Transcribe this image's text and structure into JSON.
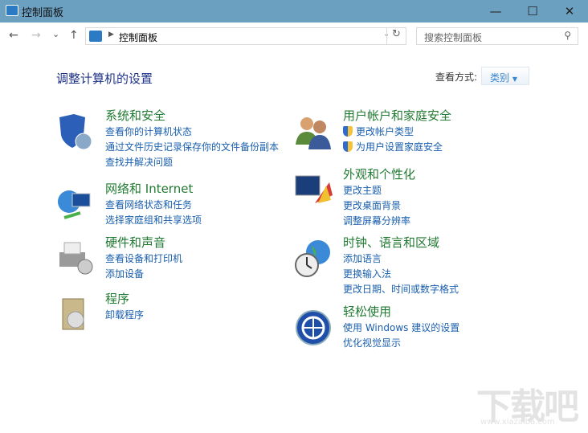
{
  "window": {
    "title": "控制面板",
    "minimize": "—",
    "maximize": "☐",
    "close": "✕"
  },
  "nav": {
    "back": "←",
    "forward": "→",
    "recent": "⌄",
    "up": "↑",
    "address": "控制面板",
    "refresh": "↻",
    "search_placeholder": "搜索控制面板"
  },
  "main": {
    "heading": "调整计算机的设置",
    "view_by_label": "查看方式:",
    "view_by_value": "类别"
  },
  "categories": [
    {
      "title": "系统和安全",
      "links": [
        "查看你的计算机状态",
        "通过文件历史记录保存你的文件备份副本",
        "查找并解决问题"
      ]
    },
    {
      "title": "网络和 Internet",
      "links": [
        "查看网络状态和任务",
        "选择家庭组和共享选项"
      ]
    },
    {
      "title": "硬件和声音",
      "links": [
        "查看设备和打印机",
        "添加设备"
      ]
    },
    {
      "title": "程序",
      "links": [
        "卸载程序"
      ]
    },
    {
      "title": "用户帐户和家庭安全",
      "links": [
        "更改帐户类型",
        "为用户设置家庭安全"
      ]
    },
    {
      "title": "外观和个性化",
      "links": [
        "更改主题",
        "更改桌面背景",
        "调整屏幕分辨率"
      ]
    },
    {
      "title": "时钟、语言和区域",
      "links": [
        "添加语言",
        "更换输入法",
        "更改日期、时间或数字格式"
      ]
    },
    {
      "title": "轻松使用",
      "links": [
        "使用 Windows 建议的设置",
        "优化视觉显示"
      ]
    }
  ],
  "watermark": {
    "text": "下载吧",
    "url": "www.xiazaiba.com"
  },
  "colors": {
    "titlebar": "#6ca0c1",
    "category_title": "#217a32",
    "link": "#1a5fae"
  }
}
